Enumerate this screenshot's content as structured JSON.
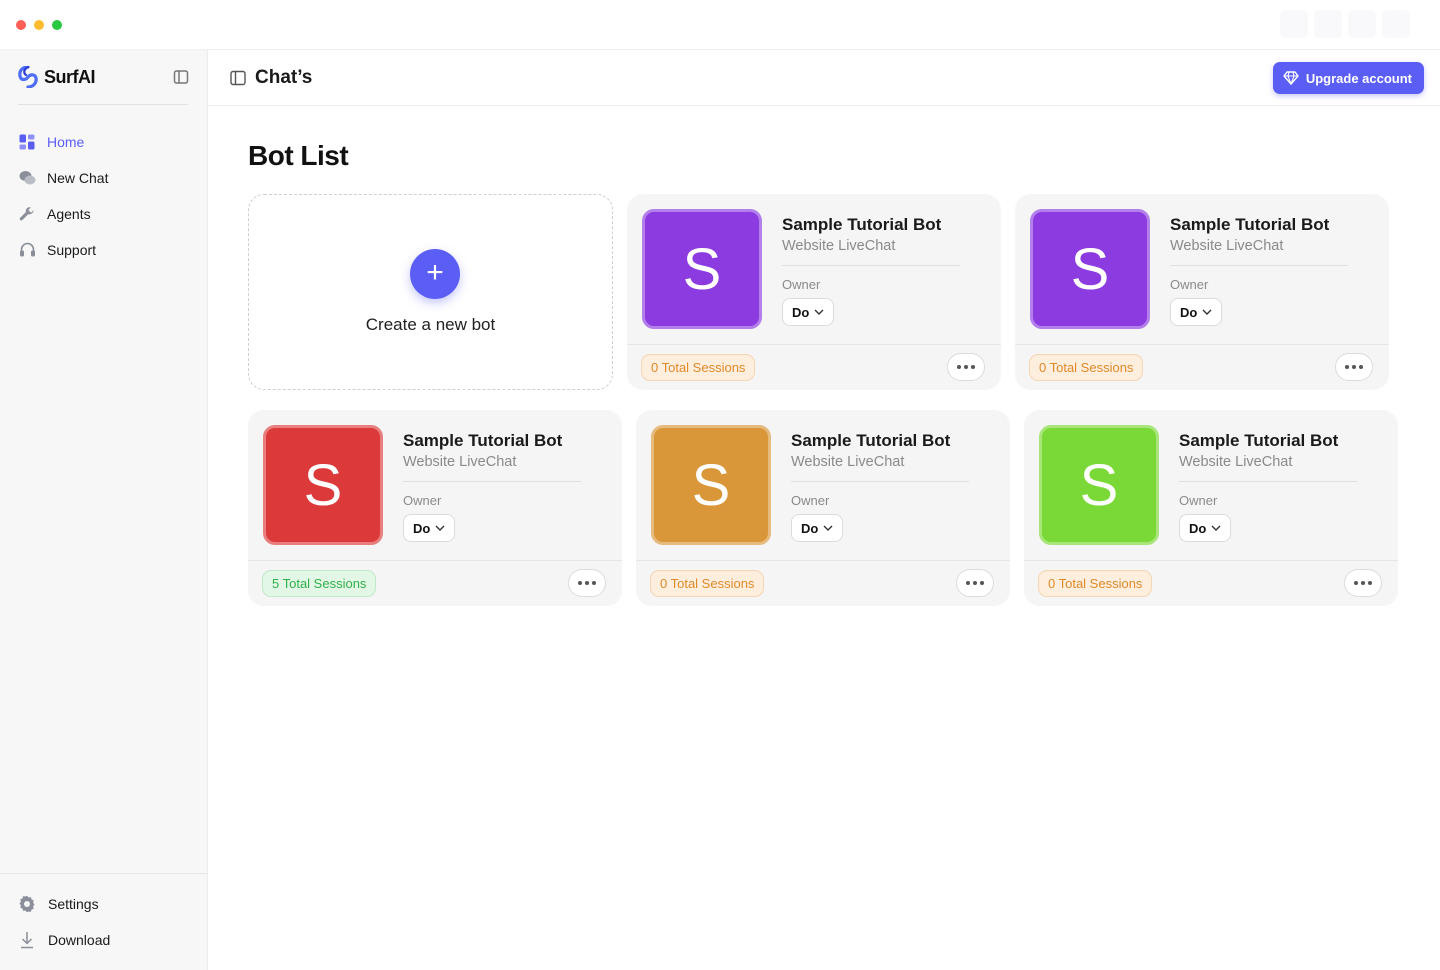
{
  "app": {
    "name": "SurfAI"
  },
  "sidebar": {
    "items": [
      {
        "label": "Home",
        "icon": "home-icon",
        "active": true
      },
      {
        "label": "New Chat",
        "icon": "chat-icon",
        "active": false
      },
      {
        "label": "Agents",
        "icon": "wrench-icon",
        "active": false
      },
      {
        "label": "Support",
        "icon": "headset-icon",
        "active": false
      }
    ],
    "bottom": [
      {
        "label": "Settings",
        "icon": "gear-icon"
      },
      {
        "label": "Download",
        "icon": "download-icon"
      }
    ]
  },
  "header": {
    "title": "Chat’s",
    "upgrade_label": "Upgrade account"
  },
  "main": {
    "title": "Bot List",
    "create_label": "Create a new bot",
    "bots": [
      {
        "initial": "S",
        "name": "Sample Tutorial Bot",
        "type": "Website LiveChat",
        "owner_label": "Owner",
        "owner": "Do",
        "sessions": "0 Total Sessions",
        "color": "#8b3be0",
        "badge": "orange"
      },
      {
        "initial": "S",
        "name": "Sample Tutorial Bot",
        "type": "Website LiveChat",
        "owner_label": "Owner",
        "owner": "Do",
        "sessions": "0 Total Sessions",
        "color": "#8b3be0",
        "badge": "orange"
      },
      {
        "initial": "S",
        "name": "Sample Tutorial Bot",
        "type": "Website LiveChat",
        "owner_label": "Owner",
        "owner": "Do",
        "sessions": "5 Total Sessions",
        "color": "#dc3a3a",
        "badge": "green"
      },
      {
        "initial": "S",
        "name": "Sample Tutorial Bot",
        "type": "Website LiveChat",
        "owner_label": "Owner",
        "owner": "Do",
        "sessions": "0 Total Sessions",
        "color": "#d9973a",
        "badge": "orange"
      },
      {
        "initial": "S",
        "name": "Sample Tutorial Bot",
        "type": "Website LiveChat",
        "owner_label": "Owner",
        "owner": "Do",
        "sessions": "0 Total Sessions",
        "color": "#7ad936",
        "badge": "orange"
      }
    ]
  },
  "colors": {
    "accent": "#5b5ef4",
    "session_orange": "#e08a2a",
    "session_green": "#2fb04a"
  }
}
